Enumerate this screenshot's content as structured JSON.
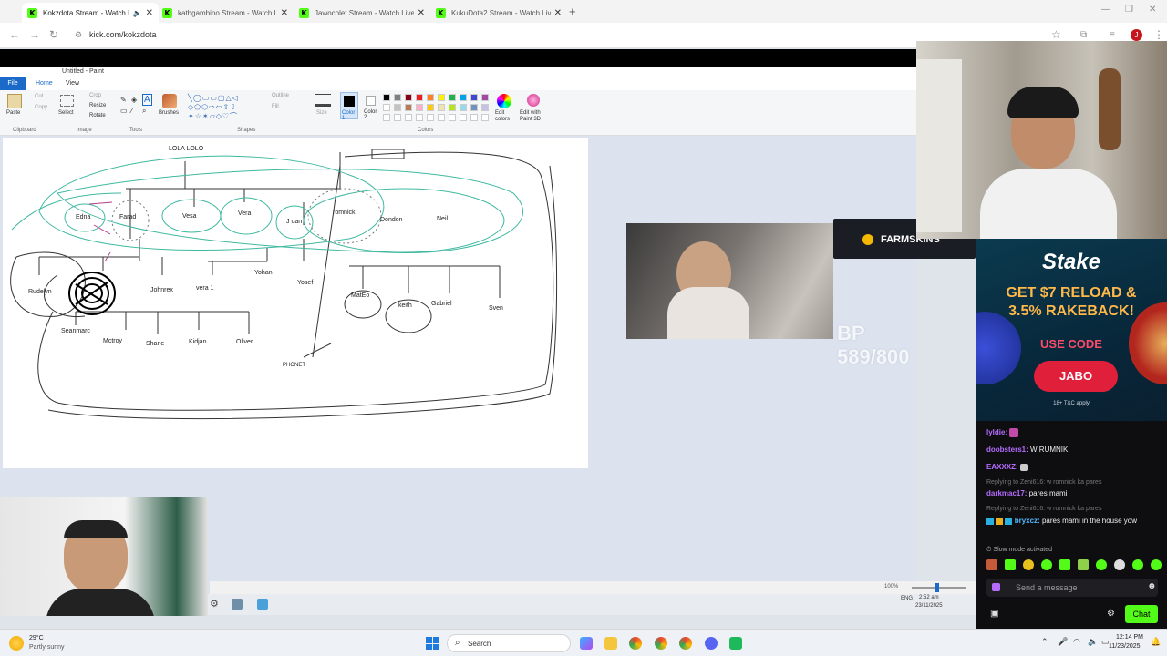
{
  "browser": {
    "tabs": [
      {
        "label": "Kokzdota Stream - Watch L",
        "active": true,
        "icon": "kick-icon"
      },
      {
        "label": "kathgambino Stream - Watch L",
        "active": false,
        "icon": "kick-icon"
      },
      {
        "label": "Jawocolet Stream - Watch Live",
        "active": false,
        "icon": "kick-icon"
      },
      {
        "label": "KukuDota2 Stream - Watch Live",
        "active": false,
        "icon": "kick-icon"
      }
    ],
    "url": "kick.com/kokzdota",
    "profile_initial": "J"
  },
  "paint": {
    "title": "Untitled - Paint",
    "menu": {
      "file": "File",
      "home": "Home",
      "view": "View"
    },
    "groups": {
      "clipboard": "Clipboard",
      "image": "Image",
      "tools": "Tools",
      "shapes": "Shapes",
      "colors": "Colors"
    },
    "buttons": {
      "paste": "Paste",
      "cut": "Cut",
      "copy": "Copy",
      "select": "Select",
      "crop": "Crop",
      "resize": "Resize",
      "rotate": "Rotate",
      "brushes": "Brushes",
      "outline": "Outline",
      "fill": "Fill",
      "size": "Size",
      "color1": "Color 1",
      "color2": "Color 2",
      "edit_colors": "Edit colors",
      "edit_paint3d": "Edit with Paint 3D"
    },
    "palette": [
      "#000000",
      "#7f7f7f",
      "#880015",
      "#ed1c24",
      "#ff7f27",
      "#fff200",
      "#22b14c",
      "#00a2e8",
      "#3f48cc",
      "#a349a4",
      "#ffffff",
      "#c3c3c3",
      "#b97a57",
      "#ffaec9",
      "#ffc90e",
      "#efe4b0",
      "#b5e61d",
      "#99d9ea",
      "#7092be",
      "#c8bfe7",
      "#ffffff",
      "#ffffff",
      "#ffffff",
      "#ffffff",
      "#ffffff",
      "#ffffff",
      "#ffffff",
      "#ffffff",
      "#ffffff",
      "#ffffff"
    ],
    "canvas_labels": {
      "top": "LOLA LOLO",
      "edna": "Edna",
      "farad": "Farad",
      "vesa": "Vesa",
      "vera": "Vera",
      "joan": "J oan",
      "romnick": "romnick",
      "dondon": "Dondon",
      "neil": "Neil",
      "rudelyn": "Rudelyn",
      "johnrex": "Johnrex",
      "vera1": "vera 1",
      "yohan": "Yohan",
      "yosef": "Yosef",
      "mateo": "MatEo",
      "keith": "keith",
      "gabriel": "Gabriel",
      "sven": "Sven",
      "seanmarc": "Seanmarc",
      "mctroy": "Mctroy",
      "shane": "Shane",
      "kidjan": "Kidjan",
      "oliver": "Oliver",
      "phonet": "PHONET"
    },
    "zoom": "100%",
    "time": "2:52 am",
    "date": "23/11/2025",
    "lang": "ENG"
  },
  "overlay": {
    "farmskins": "FARMSKINS",
    "mmr": "BP 589/800"
  },
  "chat": {
    "ad": {
      "brand": "Stake",
      "headline": "GET $7 RELOAD & 3.5% RAKEBACK!",
      "use_code": "USE CODE",
      "code": "JABO",
      "terms": "18+ T&C apply"
    },
    "messages": [
      {
        "user": "lyldie:",
        "text": "",
        "color": "#b46cff"
      },
      {
        "user": "doobsters1:",
        "text": " W RUMNIK",
        "color": "#b46cff"
      },
      {
        "user": "EAXXXZ:",
        "text": "",
        "color": "#b46cff"
      },
      {
        "reply": "Replying to Zeni616: w romnick ka pares",
        "user": "darkmac17:",
        "text": " pares mami",
        "color": "#b46cff"
      },
      {
        "reply": "Replying to Zeni616: w romnick ka pares",
        "user": "bryxcz:",
        "text": " pares mami in the house yow",
        "color": "#53b9ff"
      }
    ],
    "slow_mode": "Slow mode activated",
    "input_placeholder": "Send a message",
    "chat_button": "Chat"
  },
  "os": {
    "weather_temp": "29°C",
    "weather_desc": "Partly sunny",
    "search": "Search",
    "time": "12:14 PM",
    "date": "11/23/2025"
  },
  "colors": {
    "kick_green": "#53fc18",
    "stake_red": "#e0203a",
    "paint_blue": "#1b6ac9"
  }
}
